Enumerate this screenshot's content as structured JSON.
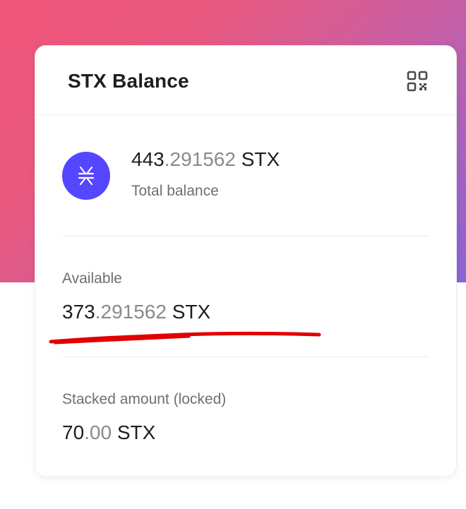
{
  "card": {
    "title": "STX Balance",
    "qr_icon": "qr-code-icon"
  },
  "total": {
    "integer": "443",
    "decimals": ".291562",
    "unit": " STX",
    "label": "Total balance",
    "avatar_icon": "stacks-logo-icon"
  },
  "available": {
    "label": "Available",
    "integer": "373",
    "decimals": ".291562",
    "unit": " STX"
  },
  "stacked": {
    "label": "Stacked amount (locked)",
    "integer": "70",
    "decimals": ".00",
    "unit": " STX"
  },
  "colors": {
    "accent": "#5546ff",
    "annotation": "#e00000",
    "gradient_start": "#f0547a",
    "gradient_end": "#8a64d6"
  }
}
